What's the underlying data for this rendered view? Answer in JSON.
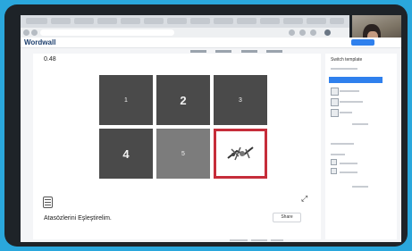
{
  "browser": {
    "tabs": [
      "",
      "",
      "",
      "",
      "",
      "",
      "",
      "",
      "",
      "",
      "",
      ""
    ],
    "address": ""
  },
  "wordwall": {
    "logo": "Wordwall",
    "header_links": [
      "",
      "",
      "",
      ""
    ],
    "cta": ""
  },
  "activity": {
    "score": "0.48",
    "tiles": [
      {
        "label": "1",
        "style": "dark",
        "small": true
      },
      {
        "label": "2",
        "style": "dark",
        "small": false
      },
      {
        "label": "3",
        "style": "dark",
        "small": true
      },
      {
        "label": "4",
        "style": "dark",
        "small": false
      },
      {
        "label": "5",
        "style": "light",
        "small": true
      },
      {
        "label": "",
        "style": "revealed",
        "small": false
      }
    ],
    "title": "Atasözlerini Eşleştirelim.",
    "share_label": "Share",
    "expand_icon": "expand-icon",
    "list_icon": "list-icon"
  },
  "social": [
    {
      "name": "facebook-icon",
      "glyph": "f",
      "color": "#3b5998"
    },
    {
      "name": "twitter-icon",
      "glyph": "t",
      "color": "#1da1f2"
    },
    {
      "name": "share-small-icon",
      "glyph": "+",
      "color": "#d0d3d8"
    }
  ],
  "sidebar": {
    "title": "Switch template"
  },
  "colors": {
    "outer": "#2aa7dc",
    "highlight": "#c62d3a",
    "accent": "#2f80ed"
  }
}
